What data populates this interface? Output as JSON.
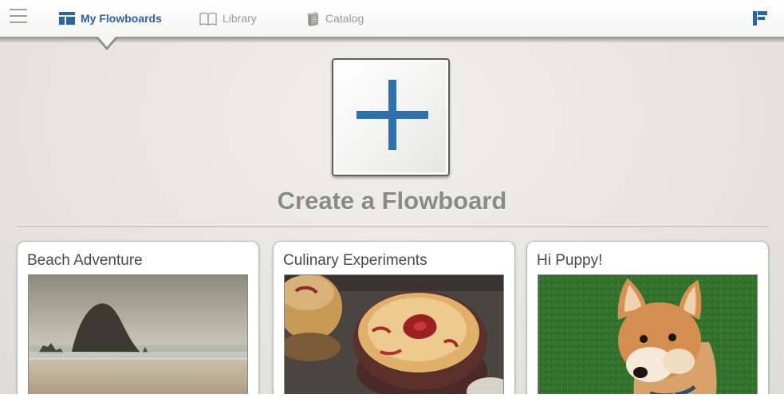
{
  "nav": {
    "menu_icon": "hamburger-menu-icon",
    "tabs": [
      {
        "label": "My Flowboards",
        "icon": "flowboards-icon",
        "active": true
      },
      {
        "label": "Library",
        "icon": "open-book-icon",
        "active": false
      },
      {
        "label": "Catalog",
        "icon": "catalog-book-icon",
        "active": false
      }
    ],
    "brand_icon": "flowboard-logo-icon",
    "accent_color": "#2d62a3"
  },
  "create": {
    "icon": "plus-icon",
    "title": "Create a Flowboard"
  },
  "flowboards": [
    {
      "title": "Beach Adventure",
      "thumbnail": "beach-rock-photo"
    },
    {
      "title": "Culinary Experiments",
      "thumbnail": "pie-photo"
    },
    {
      "title": "Hi Puppy!",
      "thumbnail": "shiba-puppy-photo"
    }
  ]
}
